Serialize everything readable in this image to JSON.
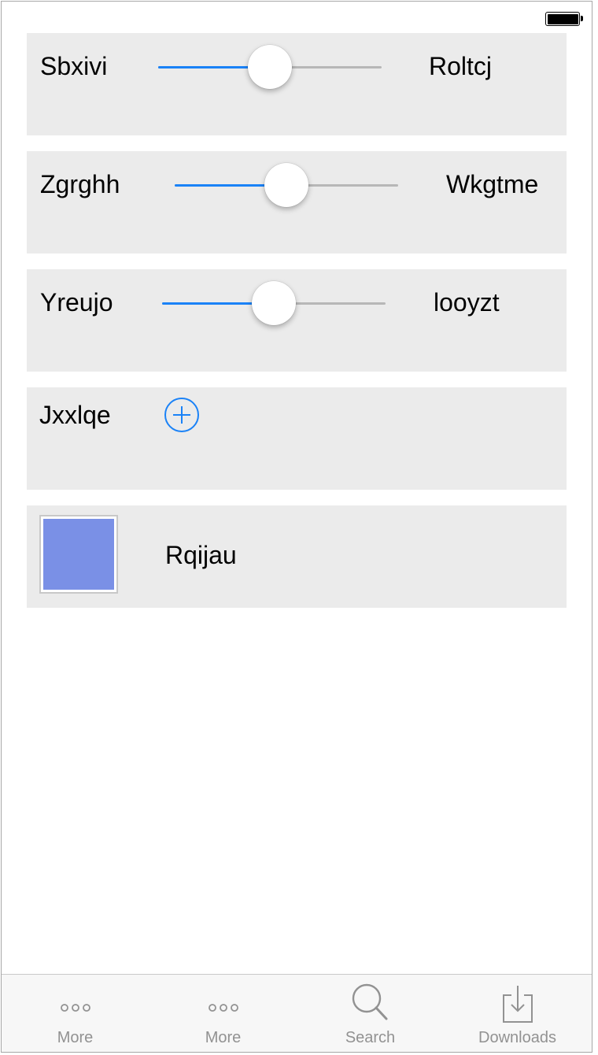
{
  "status_bar": {
    "battery_icon": "battery-full-icon"
  },
  "rows": [
    {
      "type": "slider",
      "label": "Sbxivi",
      "end_label": "Roltcj",
      "value": 0.5
    },
    {
      "type": "slider",
      "label": "Zgrghh",
      "end_label": "Wkgtme",
      "value": 0.5
    },
    {
      "type": "slider",
      "label": "Yreujo",
      "end_label": "looyzt",
      "value": 0.5
    },
    {
      "type": "add",
      "label": "Jxxlqe",
      "icon": "plus-circle-icon"
    },
    {
      "type": "color",
      "label": "Rqijau",
      "color": "#7a90e6"
    }
  ],
  "tabbar": {
    "tabs": [
      {
        "label": "More",
        "icon": "more-icon"
      },
      {
        "label": "More",
        "icon": "more-icon"
      },
      {
        "label": "Search",
        "icon": "search-icon"
      },
      {
        "label": "Downloads",
        "icon": "downloads-icon"
      }
    ]
  },
  "colors": {
    "accent": "#1a82f7",
    "card_bg": "#ebebeb",
    "tab_inactive": "#929292"
  }
}
